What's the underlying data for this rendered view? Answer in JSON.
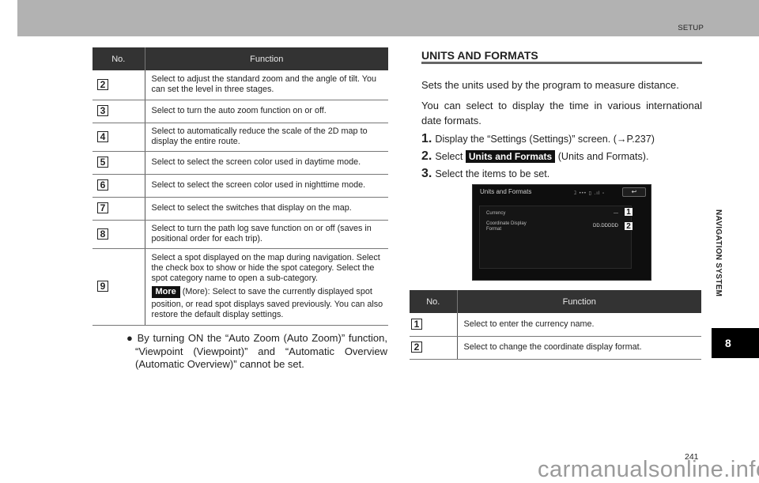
{
  "header": {
    "section_label": "SETUP"
  },
  "left_table": {
    "headers": {
      "no": "No.",
      "function": "Function"
    },
    "rows": [
      {
        "no": "2",
        "text": "Select to adjust the standard zoom and the angle of tilt. You can set the level in three stages."
      },
      {
        "no": "3",
        "text": "Select to turn the auto zoom function on or off."
      },
      {
        "no": "4",
        "text": "Select to automatically reduce the scale of the 2D map to display the entire route."
      },
      {
        "no": "5",
        "text": "Select to select the screen color used in daytime mode."
      },
      {
        "no": "6",
        "text": "Select to select the screen color used in nighttime mode."
      },
      {
        "no": "7",
        "text": "Select to select the switches that display on the map."
      },
      {
        "no": "8",
        "text": "Select to turn the path log save function on or off (saves in positional order for each trip)."
      },
      {
        "no": "9",
        "text_before": "Select a spot displayed on the map during navigation. Select the check box to show or hide the spot category. Select the spot category name to open a sub-category.",
        "button": "More",
        "text_after": " (More): Select to save the currently displayed spot position, or read spot displays saved previously. You can also restore the default display settings."
      }
    ]
  },
  "note": "● By turning ON the “Auto Zoom (Auto Zoom)” function, “Viewpoint (Viewpoint)” and “Automatic Overview (Automatic Overview)” cannot be set.",
  "section": {
    "title": "UNITS AND FORMATS",
    "para1": "Sets the units used by the program to measure distance.",
    "para2": "You can select to display the time in various international date formats.",
    "steps": [
      {
        "num": "1.",
        "text": "Display the “Settings (Settings)” screen. (→P.237)"
      },
      {
        "num": "2.",
        "prefix": "Select ",
        "button": "Units and Formats",
        "suffix": " (Units and Formats)."
      },
      {
        "num": "3.",
        "text": "Select the items to be set."
      }
    ]
  },
  "screen": {
    "title": "Units and Formats",
    "status": "ﾕ ••• ▯ .ıl ▫",
    "back": "↩",
    "rows": [
      {
        "label": "Currency",
        "value": "---",
        "callout": "1"
      },
      {
        "label": "Coordinate Display Format",
        "value": "DD.DDDDD",
        "callout": "2"
      }
    ]
  },
  "right_table": {
    "headers": {
      "no": "No.",
      "function": "Function"
    },
    "rows": [
      {
        "no": "1",
        "text": "Select to enter the currency name."
      },
      {
        "no": "2",
        "text": "Select to change the coordinate display format."
      }
    ]
  },
  "side": {
    "chapter_title": "NAVIGATION SYSTEM",
    "chapter_num": "8"
  },
  "footer": {
    "page_number": "241",
    "watermark": "carmanualsonline.info"
  }
}
